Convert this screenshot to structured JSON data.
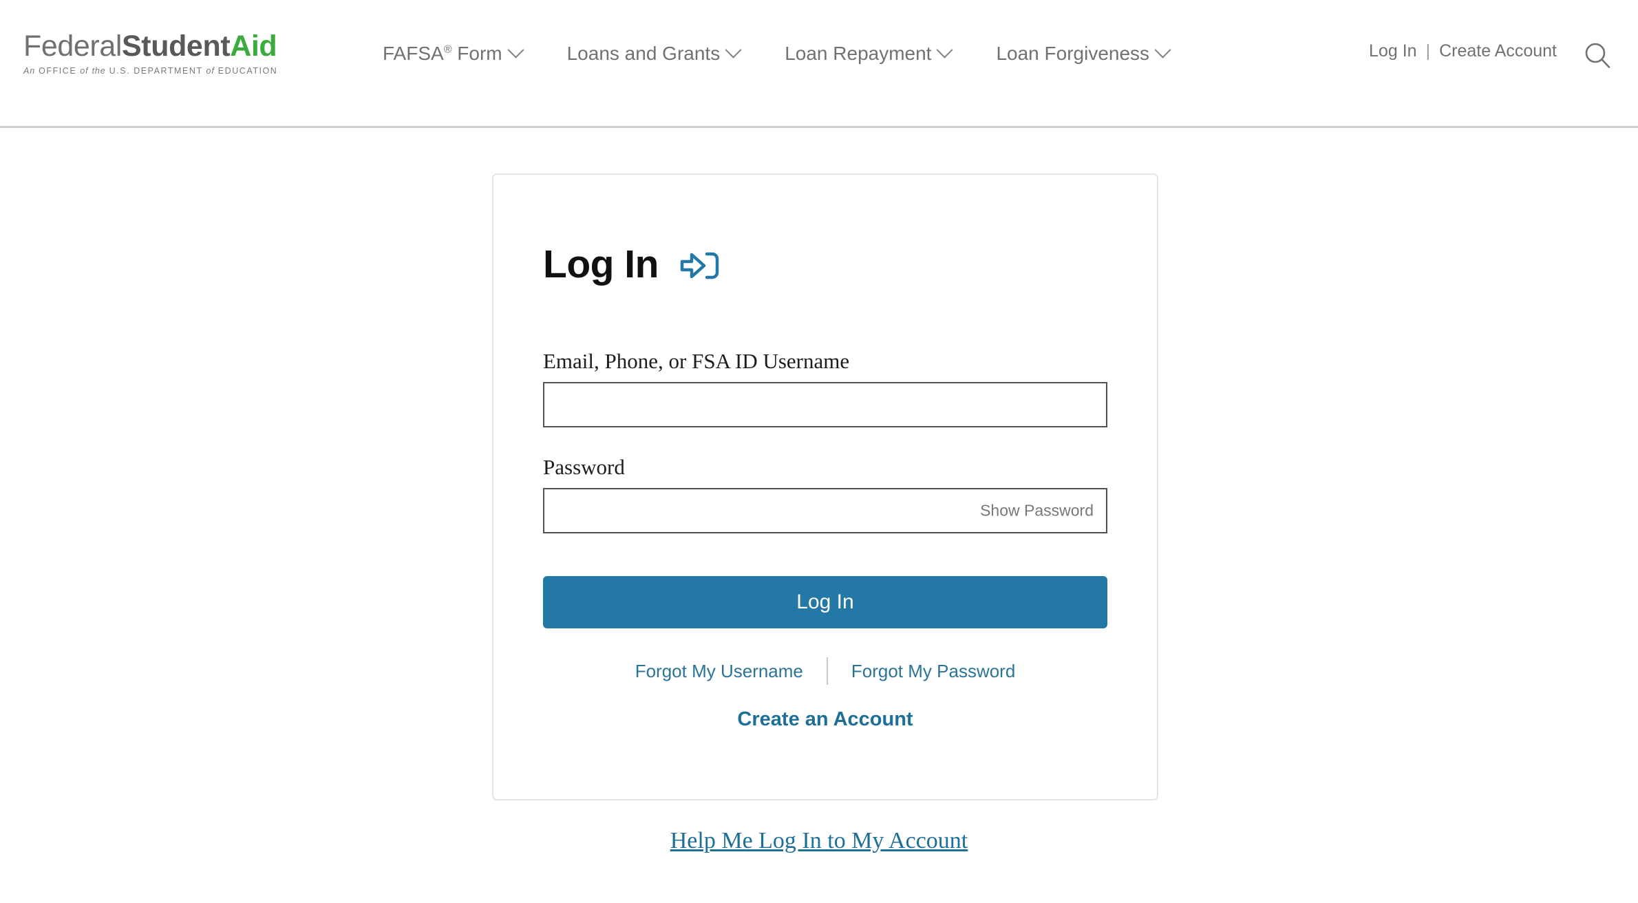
{
  "header": {
    "logo": {
      "word_federal": "Federal",
      "word_student": "Student",
      "word_aid": "Aid",
      "tagline_an": "An",
      "tagline_office": "OFFICE",
      "tagline_of1": "of",
      "tagline_the": "the",
      "tagline_dept": "U.S. DEPARTMENT",
      "tagline_of2": "of",
      "tagline_education": "EDUCATION",
      "color_federal": "#6e7072",
      "color_student": "#58595b",
      "color_aid": "#3aab3c"
    },
    "nav": [
      {
        "label": "FAFSA",
        "sup": "®",
        "suffix": " Form",
        "icon": "chevron-down-icon"
      },
      {
        "label": "Loans and Grants",
        "sup": "",
        "suffix": "",
        "icon": "chevron-down-icon"
      },
      {
        "label": "Loan Repayment",
        "sup": "",
        "suffix": "",
        "icon": "chevron-down-icon"
      },
      {
        "label": "Loan Forgiveness",
        "sup": "",
        "suffix": "",
        "icon": "chevron-down-icon"
      }
    ],
    "utility": {
      "log_in": "Log In",
      "separator": "|",
      "create_account": "Create Account",
      "search_icon": "search-icon"
    }
  },
  "login_card": {
    "title": "Log In",
    "title_icon": "sign-in-arrow-icon",
    "title_icon_color": "#2378a5",
    "username": {
      "label": "Email, Phone, or FSA ID Username",
      "value": "",
      "placeholder": ""
    },
    "password": {
      "label": "Password",
      "value": "",
      "placeholder": "",
      "show_password_label": "Show Password"
    },
    "submit_label": "Log In",
    "submit_color": "#2378a5",
    "forgot_username": "Forgot My Username",
    "forgot_password": "Forgot My Password",
    "create_account": "Create an Account",
    "link_color": "#2a7498"
  },
  "footer": {
    "help_link": "Help Me Log In to My Account"
  }
}
